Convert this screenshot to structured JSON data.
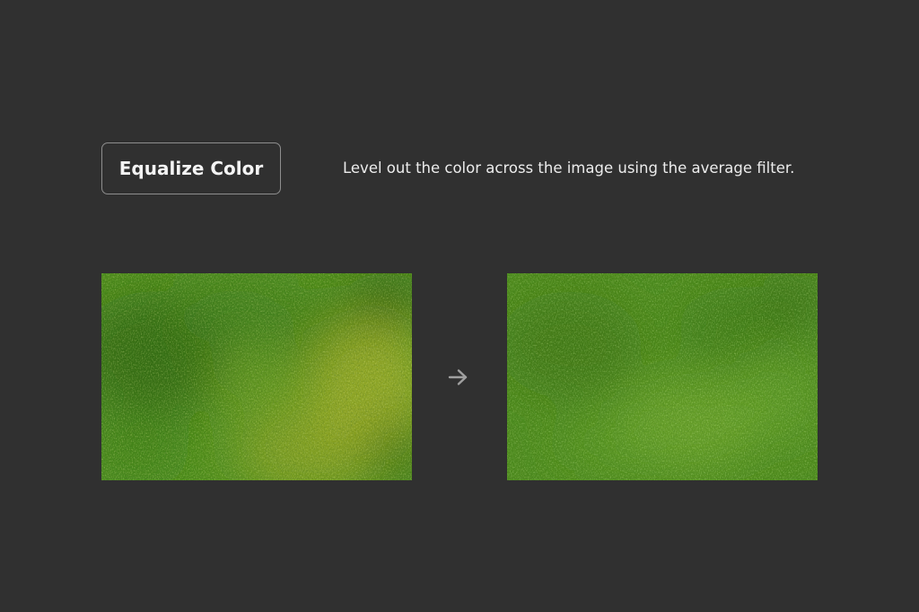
{
  "feature": {
    "button_label": "Equalize Color",
    "description": "Level out the color across the image using the average filter."
  },
  "images": {
    "before": {
      "icon": "grass-texture-uneven",
      "colors": {
        "base": "#4f8e1f",
        "dark": "#2f6412",
        "light": "#a9b02a"
      }
    },
    "after": {
      "icon": "grass-texture-equalized",
      "colors": {
        "base": "#4d8a1e",
        "dark": "#3a7016",
        "light": "#7cb034"
      }
    },
    "transition_icon": "arrow-right-icon"
  },
  "colors": {
    "background": "#303030",
    "button_border": "#8e8e8e",
    "text": "#ececec",
    "arrow": "#a0a0a0"
  }
}
